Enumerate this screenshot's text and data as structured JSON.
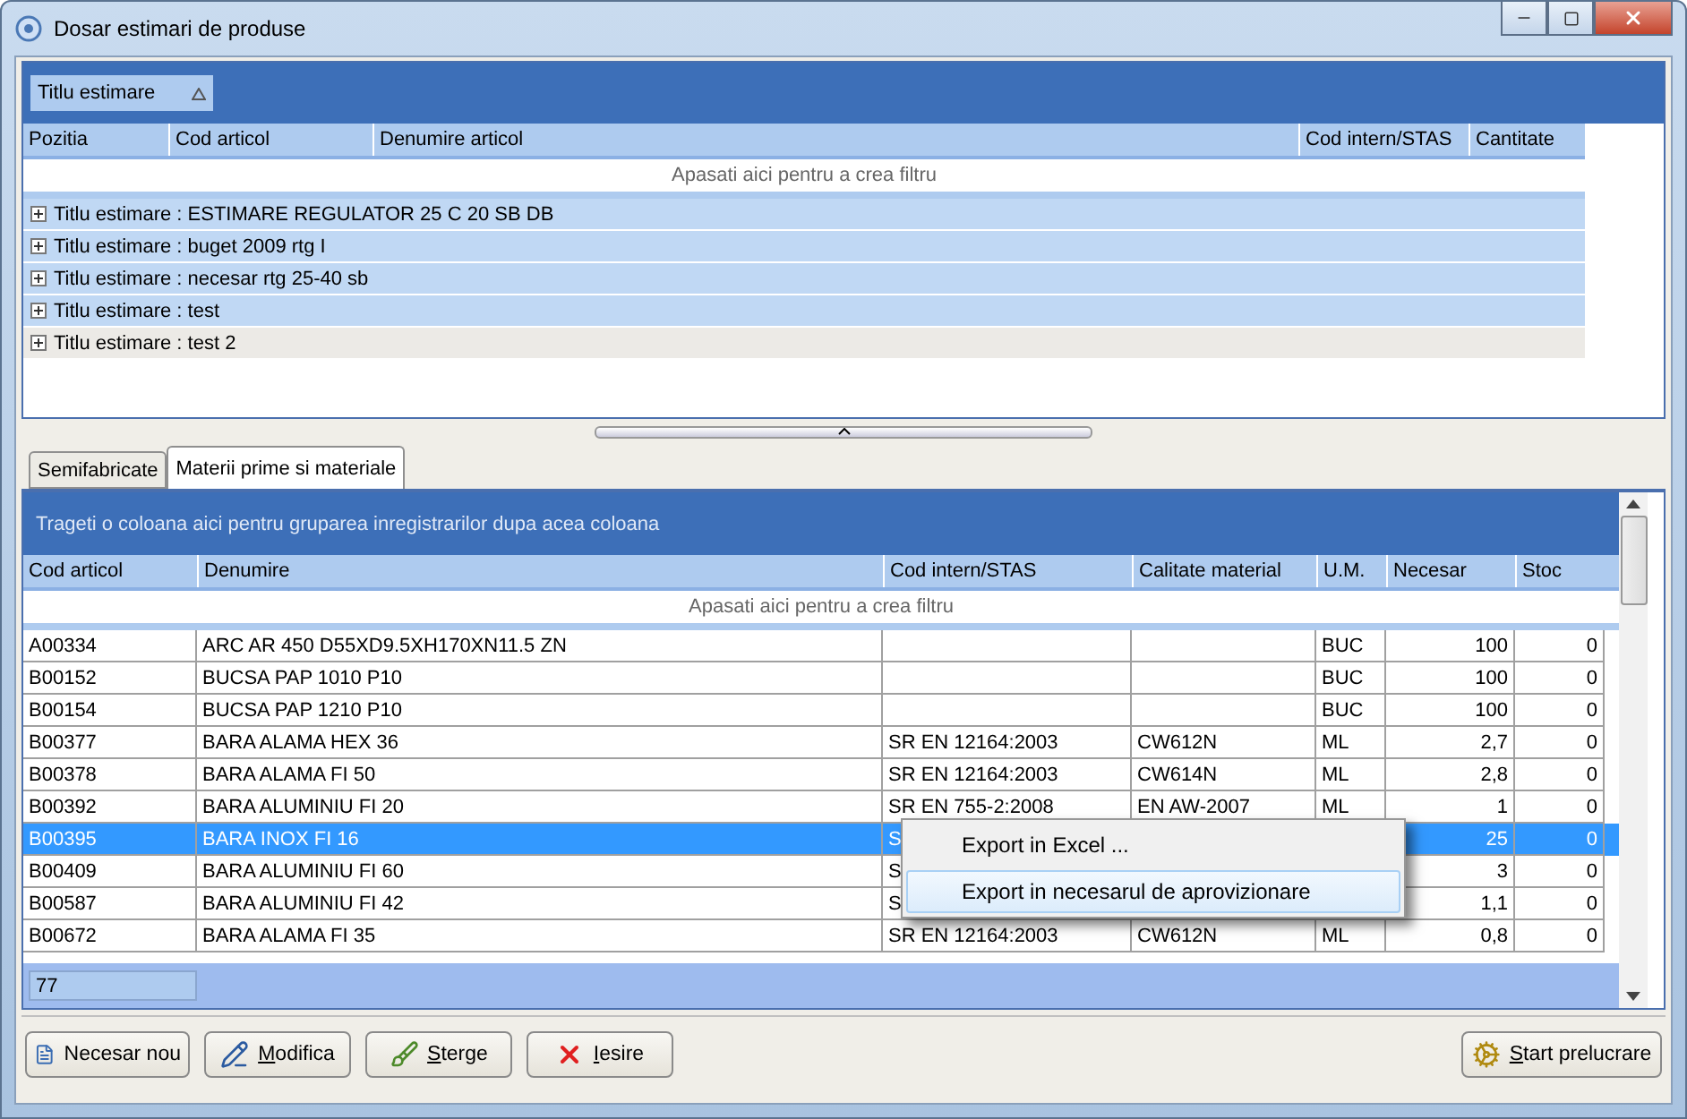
{
  "window": {
    "title": "Dosar estimari de produse"
  },
  "top_grid": {
    "group_chip": "Titlu estimare",
    "columns": [
      "Pozitia",
      "Cod articol",
      "Denumire articol",
      "Cod intern/STAS",
      "Cantitate"
    ],
    "filter_hint": "Apasati aici pentru a  crea filtru",
    "groups": [
      {
        "label": "Titlu estimare : ESTIMARE REGULATOR 25 C 20 SB DB",
        "expanded": false,
        "selected": false
      },
      {
        "label": "Titlu estimare : buget 2009 rtg I",
        "expanded": false,
        "selected": false
      },
      {
        "label": "Titlu estimare : necesar rtg 25-40 sb",
        "expanded": false,
        "selected": false
      },
      {
        "label": "Titlu estimare : test",
        "expanded": false,
        "selected": false
      },
      {
        "label": "Titlu estimare : test 2",
        "expanded": false,
        "selected": true
      }
    ]
  },
  "tabs": [
    {
      "label": "Semifabricate",
      "selected": false
    },
    {
      "label": "Materii prime si materiale",
      "selected": true
    }
  ],
  "grid": {
    "group_hint": "Trageti o coloana aici pentru gruparea inregistrarilor dupa acea coloana",
    "columns": [
      "Cod articol",
      "Denumire",
      "Cod intern/STAS",
      "Calitate material",
      "U.M.",
      "Necesar",
      "Stoc"
    ],
    "filter_hint": "Apasati aici pentru a  crea filtru",
    "rows": [
      {
        "cells": [
          "A00334",
          "ARC AR 450 D55XD9.5XH170XN11.5 ZN",
          null,
          null,
          "BUC",
          "100",
          "0"
        ],
        "selected": false
      },
      {
        "cells": [
          "B00152",
          "BUCSA PAP 1010 P10",
          null,
          null,
          "BUC",
          "100",
          "0"
        ],
        "selected": false
      },
      {
        "cells": [
          "B00154",
          "BUCSA PAP 1210 P10",
          null,
          null,
          "BUC",
          "100",
          "0"
        ],
        "selected": false
      },
      {
        "cells": [
          "B00377",
          "BARA ALAMA HEX 36",
          "SR EN 12164:2003",
          "CW612N",
          "ML",
          "2,7",
          "0"
        ],
        "selected": false
      },
      {
        "cells": [
          "B00378",
          "BARA ALAMA FI 50",
          "SR EN 12164:2003",
          "CW614N",
          "ML",
          "2,8",
          "0"
        ],
        "selected": false
      },
      {
        "cells": [
          "B00392",
          "BARA ALUMINIU FI 20",
          "SR EN 755-2:2008",
          "EN AW-2007",
          "ML",
          "1",
          "0"
        ],
        "selected": false
      },
      {
        "cells": [
          "B00395",
          "BARA INOX FI 16",
          "S",
          null,
          null,
          "25",
          "0"
        ],
        "selected": true
      },
      {
        "cells": [
          "B00409",
          "BARA ALUMINIU FI 60",
          "S",
          null,
          null,
          "3",
          "0"
        ],
        "selected": false
      },
      {
        "cells": [
          "B00587",
          "BARA ALUMINIU FI 42",
          "S",
          null,
          null,
          "1,1",
          "0"
        ],
        "selected": false
      },
      {
        "cells": [
          "B00672",
          "BARA ALAMA FI 35",
          "SR EN 12164:2003",
          "CW612N",
          "ML",
          "0,8",
          "0"
        ],
        "selected": false
      }
    ],
    "footer_count": "77"
  },
  "context_menu": [
    {
      "label": "Export in Excel ...",
      "selected": false
    },
    {
      "label": "Export in necesarul de aprovizionare",
      "selected": true
    }
  ],
  "buttons": [
    {
      "kind": "new",
      "label": "Necesar nou",
      "underline_first": false
    },
    {
      "kind": "edit",
      "label": "Modifica",
      "underline_first": true
    },
    {
      "kind": "delete",
      "label": "Sterge",
      "underline_first": true
    },
    {
      "kind": "exit",
      "label": "Iesire",
      "underline_first": true
    }
  ],
  "start_button": {
    "kind": "start",
    "label": "Start prelucrare",
    "underline_first": true
  }
}
